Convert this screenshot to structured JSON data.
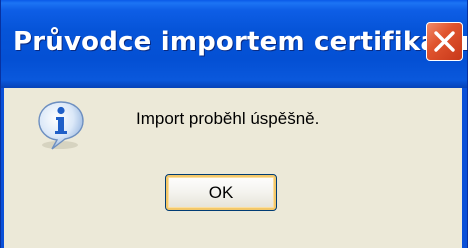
{
  "window": {
    "title": "Průvodce importem certifikátu"
  },
  "dialog": {
    "icon": "info-icon",
    "message": "Import proběhl úspěšně.",
    "ok_label": "OK"
  },
  "colors": {
    "titlebar": "#0a50d8",
    "client_background": "#ece9d8",
    "close_button": "#e0542e",
    "info_icon": "#1f5fc8"
  }
}
